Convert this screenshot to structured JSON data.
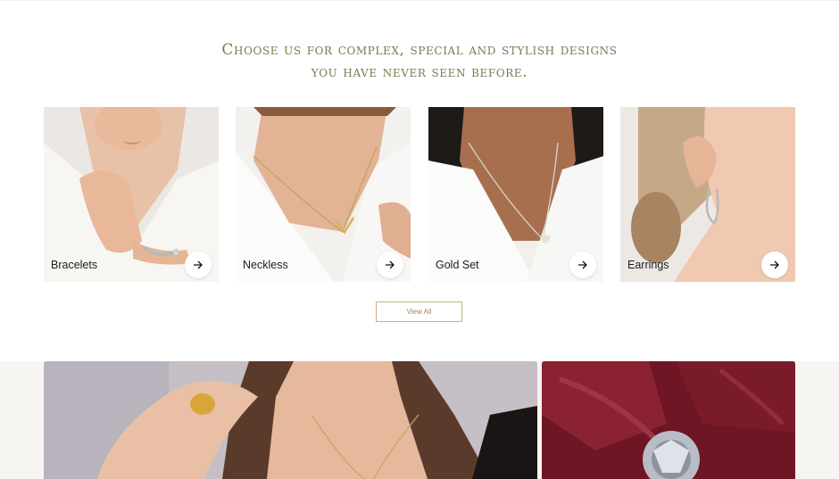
{
  "headline": {
    "line1": "Choose us for complex, special and stylish designs",
    "line2": "you have never seen before."
  },
  "categories": [
    {
      "label": "Bracelets",
      "icon": "arrow-right-icon"
    },
    {
      "label": "Neckless",
      "icon": "arrow-right-icon"
    },
    {
      "label": "Gold Set",
      "icon": "arrow-right-icon"
    },
    {
      "label": "Earrings",
      "icon": "arrow-right-icon"
    }
  ],
  "view_all_label": "View All",
  "colors": {
    "headline": "#7a7a52",
    "button_border": "#c9b37a",
    "band_background": "#f6f5f2"
  }
}
